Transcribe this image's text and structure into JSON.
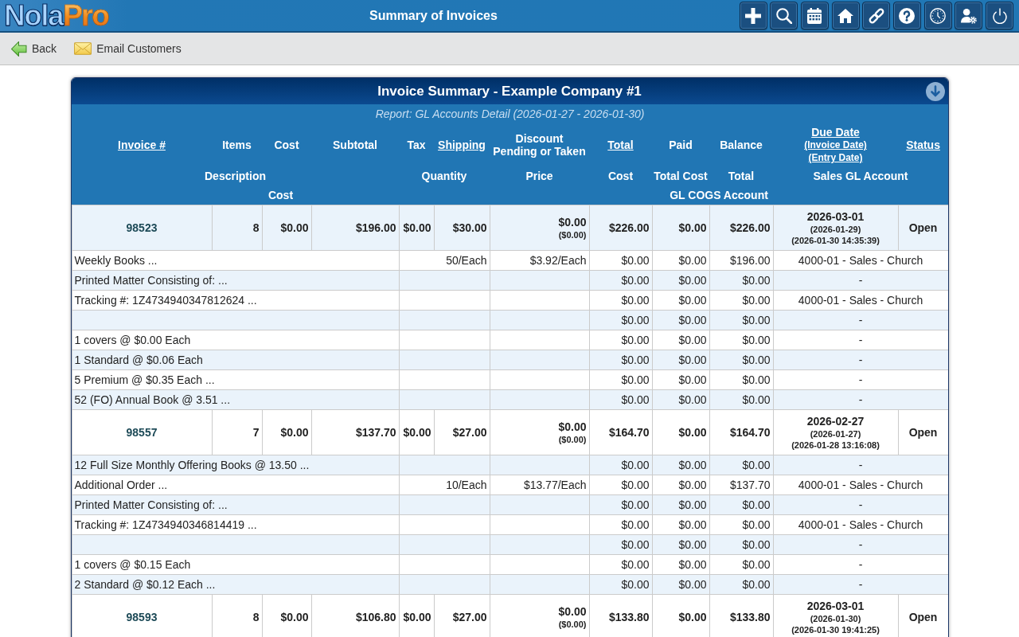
{
  "app": {
    "logo": [
      "Nola",
      "Pro"
    ],
    "title": "Summary of Invoices"
  },
  "actions": [
    {
      "kind": "back",
      "label": "Back"
    },
    {
      "kind": "email",
      "label": "Email Customers"
    }
  ],
  "report": {
    "title": "Invoice Summary - Example Company #1",
    "subtitle": "Report: GL Accounts Detail (2026-01-27 - 2026-01-30)"
  },
  "table": {
    "columns": [
      {
        "lines": [
          "Invoice #"
        ],
        "link": true
      },
      {
        "lines": [
          "Items"
        ],
        "link": false
      },
      {
        "lines": [
          "Cost"
        ],
        "link": false
      },
      {
        "lines": [
          "Subtotal"
        ],
        "link": false
      },
      {
        "lines": [
          "Tax"
        ],
        "link": false
      },
      {
        "lines": [
          "Shipping"
        ],
        "link": true
      },
      {
        "lines": [
          "Discount",
          "Pending or Taken"
        ],
        "link": false
      },
      {
        "lines": [
          "Total"
        ],
        "link": true
      },
      {
        "lines": [
          "Paid"
        ],
        "link": false
      },
      {
        "lines": [
          "Balance"
        ],
        "link": false
      },
      {
        "lines": [
          "Due Date",
          "(Invoice Date)",
          "(Entry Date)"
        ],
        "link": true
      },
      {
        "lines": [
          "Status"
        ],
        "link": true
      }
    ],
    "line_columns": [
      "Description",
      "Quantity",
      "Price",
      "Cost",
      "Total Cost",
      "Total",
      "Sales GL Account"
    ],
    "cogs_columns": [
      "Cost",
      "GL COGS Account"
    ],
    "invoices": [
      {
        "number": "98523",
        "items": "8",
        "cost": "$0.00",
        "subtotal": "$196.00",
        "tax": "$0.00",
        "shipping": "$30.00",
        "discount": "$0.00",
        "discount_taken": "($0.00)",
        "total": "$226.00",
        "paid": "$0.00",
        "balance": "$226.00",
        "due_date": "2026-03-01",
        "invoice_date": "(2026-01-29)",
        "entry_date": "(2026-01-30 14:35:39)",
        "status": "Open",
        "lines": [
          {
            "description": "Weekly Books ...",
            "quantity": "50/Each",
            "price": "$3.92/Each",
            "cost": "$0.00",
            "total_cost": "$0.00",
            "total": "$196.00",
            "sales_gl_account": "4000-01 - Sales - Church"
          },
          {
            "description": "Printed Matter Consisting of: ...",
            "cost": "$0.00",
            "total_cost": "$0.00",
            "total": "$0.00",
            "sales_gl_account": "-"
          },
          {
            "description": "Tracking #: 1Z4734940347812624 ...",
            "cost": "$0.00",
            "total_cost": "$0.00",
            "total": "$0.00",
            "sales_gl_account": "4000-01 - Sales - Church"
          },
          {
            "cost": "$0.00",
            "total_cost": "$0.00",
            "total": "$0.00",
            "sales_gl_account": "-"
          },
          {
            "description": "1 covers @ $0.00 Each",
            "cost": "$0.00",
            "total_cost": "$0.00",
            "total": "$0.00",
            "sales_gl_account": "-"
          },
          {
            "description": "1 Standard @ $0.06 Each",
            "cost": "$0.00",
            "total_cost": "$0.00",
            "total": "$0.00",
            "sales_gl_account": "-"
          },
          {
            "description": "5 Premium @ $0.35 Each ...",
            "cost": "$0.00",
            "total_cost": "$0.00",
            "total": "$0.00",
            "sales_gl_account": "-"
          },
          {
            "description": "52 (FO) Annual Book @ 3.51 ...",
            "cost": "$0.00",
            "total_cost": "$0.00",
            "total": "$0.00",
            "sales_gl_account": "-"
          }
        ]
      },
      {
        "number": "98557",
        "items": "7",
        "cost": "$0.00",
        "subtotal": "$137.70",
        "tax": "$0.00",
        "shipping": "$27.00",
        "discount": "$0.00",
        "discount_taken": "($0.00)",
        "total": "$164.70",
        "paid": "$0.00",
        "balance": "$164.70",
        "due_date": "2026-02-27",
        "invoice_date": "(2026-01-27)",
        "entry_date": "(2026-01-28 13:16:08)",
        "status": "Open",
        "lines": [
          {
            "description": "12 Full Size Monthly Offering Books @ 13.50 ...",
            "cost": "$0.00",
            "total_cost": "$0.00",
            "total": "$0.00",
            "sales_gl_account": "-"
          },
          {
            "description": "Additional Order ...",
            "quantity": "10/Each",
            "price": "$13.77/Each",
            "cost": "$0.00",
            "total_cost": "$0.00",
            "total": "$137.70",
            "sales_gl_account": "4000-01 - Sales - Church"
          },
          {
            "description": "Printed Matter Consisting of: ...",
            "cost": "$0.00",
            "total_cost": "$0.00",
            "total": "$0.00",
            "sales_gl_account": "-"
          },
          {
            "description": "Tracking #: 1Z4734940346814419 ...",
            "cost": "$0.00",
            "total_cost": "$0.00",
            "total": "$0.00",
            "sales_gl_account": "4000-01 - Sales - Church"
          },
          {
            "cost": "$0.00",
            "total_cost": "$0.00",
            "total": "$0.00",
            "sales_gl_account": "-"
          },
          {
            "description": "1 covers @ $0.15 Each",
            "cost": "$0.00",
            "total_cost": "$0.00",
            "total": "$0.00",
            "sales_gl_account": "-"
          },
          {
            "description": "2 Standard @ $0.12 Each ...",
            "cost": "$0.00",
            "total_cost": "$0.00",
            "total": "$0.00",
            "sales_gl_account": "-"
          }
        ]
      },
      {
        "number": "98593",
        "items": "8",
        "cost": "$0.00",
        "subtotal": "$106.80",
        "tax": "$0.00",
        "shipping": "$27.00",
        "discount": "$0.00",
        "discount_taken": "($0.00)",
        "total": "$133.80",
        "paid": "$0.00",
        "balance": "$133.80",
        "due_date": "2026-03-01",
        "invoice_date": "(2026-01-30)",
        "entry_date": "(2026-01-30 19:41:25)",
        "status": "Open"
      }
    ]
  }
}
